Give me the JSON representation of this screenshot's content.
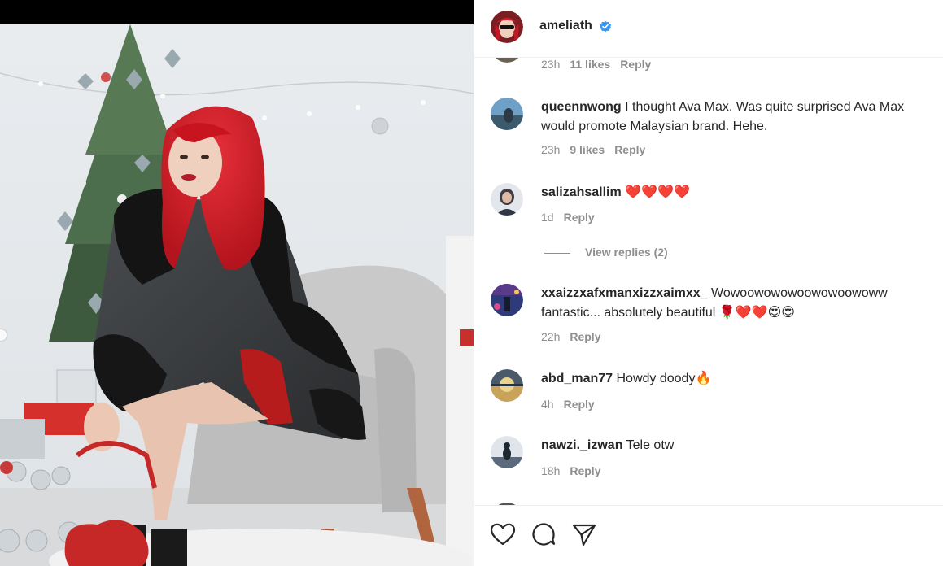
{
  "post": {
    "author": "ameliath",
    "verified": true
  },
  "comments": [
    {
      "id": "c0",
      "time": "23h",
      "likes": "11 likes",
      "reply": "Reply"
    },
    {
      "id": "c1",
      "username": "queennwong",
      "text": "I thought Ava Max. Was quite surprised Ava Max would promote Malaysian brand. Hehe.",
      "time": "23h",
      "likes": "9 likes",
      "reply": "Reply"
    },
    {
      "id": "c2",
      "username": "salizahsallim",
      "text": "❤️❤️❤️❤️",
      "time": "1d",
      "reply": "Reply",
      "view_replies": "View replies (2)"
    },
    {
      "id": "c3",
      "username": "xxaizzxafxmanxizzxaimxx_",
      "text": "Wowoowowowoowowoowoww fantastic... absolutely beautiful 🌹❤️❤️😍😍",
      "time": "22h",
      "reply": "Reply"
    },
    {
      "id": "c4",
      "username": "abd_man77",
      "text": "Howdy doody🔥",
      "time": "4h",
      "reply": "Reply"
    },
    {
      "id": "c5",
      "username": "nawzi._izwan",
      "text": "Tele otw",
      "time": "18h",
      "reply": "Reply"
    }
  ],
  "actions": {
    "like_icon": "heart-outline-icon",
    "comment_icon": "speech-bubble-icon",
    "share_icon": "paper-plane-icon"
  },
  "colors": {
    "text": "#262626",
    "secondary_text": "#8e8e8e",
    "verified_blue": "#3897f0",
    "heart_red": "#e0245e"
  }
}
